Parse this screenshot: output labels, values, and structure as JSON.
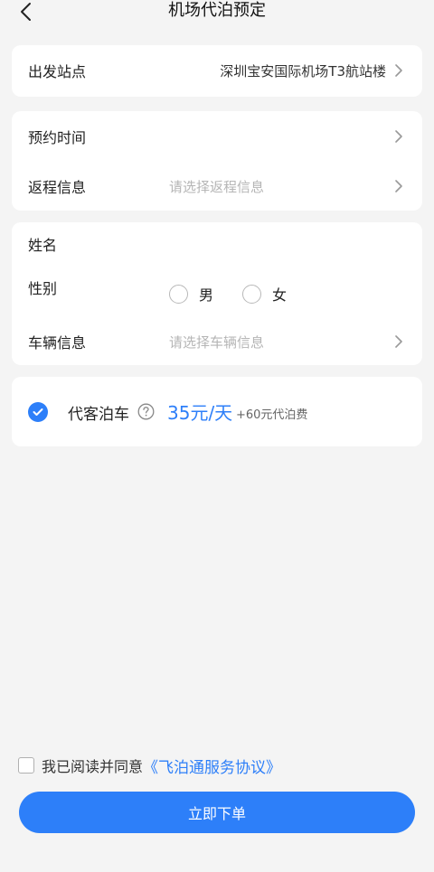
{
  "header": {
    "title": "机场代泊预定",
    "back_icon": "chevron-left-icon"
  },
  "departure": {
    "label": "出发站点",
    "value": "深圳宝安国际机场T3航站楼"
  },
  "schedule": {
    "reserve_label": "预约时间",
    "return_label": "返程信息",
    "return_placeholder": "请选择返程信息"
  },
  "person": {
    "name_label": "姓名",
    "gender_label": "性别",
    "gender_options": [
      "男",
      "女"
    ],
    "vehicle_label": "车辆信息",
    "vehicle_placeholder": "请选择车辆信息"
  },
  "service": {
    "checked": true,
    "name": "代客泊车",
    "price": "35元/天",
    "extra_fee": "+60元代泊费",
    "accent_color": "#2d7ff9"
  },
  "agreement": {
    "checked": false,
    "text": "我已阅读并同意",
    "link": "《飞泊通服务协议》"
  },
  "submit": {
    "label": "立即下单"
  }
}
